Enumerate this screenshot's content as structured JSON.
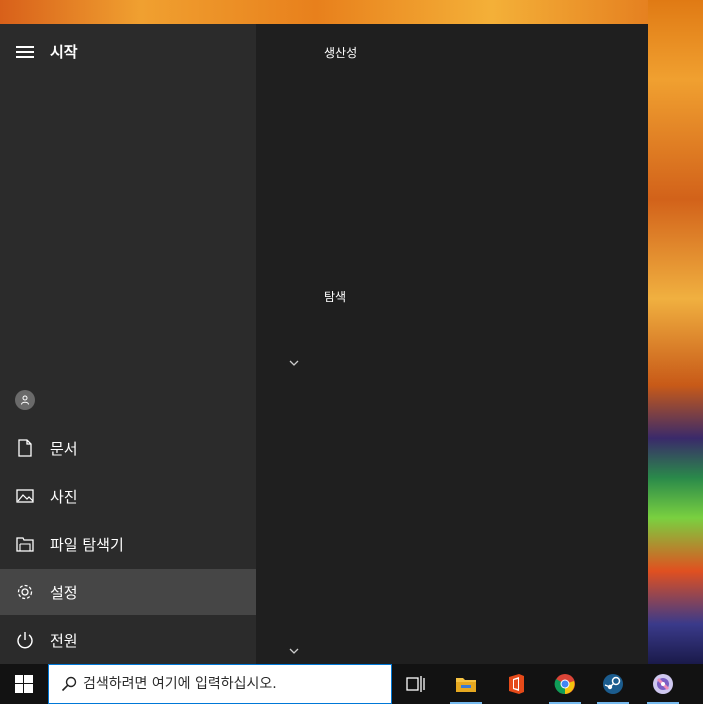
{
  "start_menu": {
    "title": "시작",
    "nav": {
      "documents": "문서",
      "pictures": "사진",
      "file_explorer": "파일 탐색기",
      "settings": "설정",
      "power": "전원"
    },
    "groups": [
      {
        "title": "생산성"
      },
      {
        "title": "탐색"
      }
    ]
  },
  "taskbar": {
    "search_placeholder": "검색하려면 여기에 입력하십시오.",
    "pinned_apps": [
      "task-view-icon",
      "file-explorer-icon",
      "office-icon",
      "chrome-icon",
      "steam-icon",
      "app-icon"
    ]
  },
  "colors": {
    "accent": "#0078d7",
    "menu_left": "#2b2b2b",
    "menu_right": "#1f1f1f",
    "active_item": "#464646",
    "taskbar": "#121212",
    "running_indicator": "#76b9ed"
  }
}
